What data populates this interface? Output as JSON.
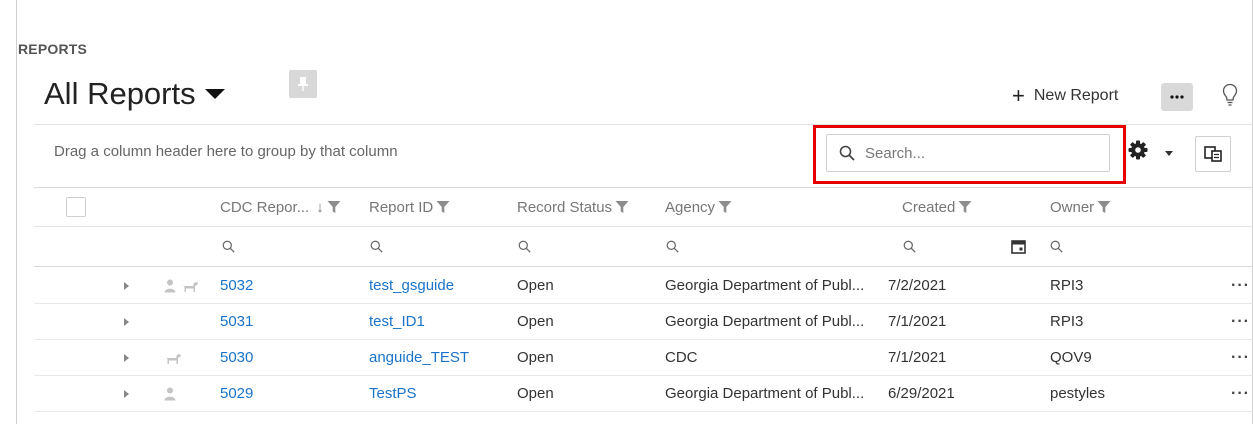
{
  "header": {
    "section": "REPORTS",
    "title": "All Reports",
    "new_report_label": "New Report"
  },
  "toolbar": {
    "group_hint": "Drag a column header here to group by that column",
    "search_placeholder": "Search..."
  },
  "table": {
    "columns": [
      "CDC Repor...",
      "Report ID",
      "Record Status",
      "Agency",
      "Created",
      "Owner"
    ],
    "sort_indicator": "↓",
    "rows": [
      {
        "icons": [
          "person-icon",
          "dog-icon"
        ],
        "cdc_report": "5032",
        "report_id": "test_gsguide",
        "status": "Open",
        "agency": "Georgia Department of Publ...",
        "created": "7/2/2021",
        "owner": "RPI3"
      },
      {
        "icons": [],
        "cdc_report": "5031",
        "report_id": "test_ID1",
        "status": "Open",
        "agency": "Georgia Department of Publ...",
        "created": "7/1/2021",
        "owner": "RPI3"
      },
      {
        "icons": [
          "dog-icon"
        ],
        "cdc_report": "5030",
        "report_id": "anguide_TEST",
        "status": "Open",
        "agency": "CDC",
        "created": "7/1/2021",
        "owner": "QOV9"
      },
      {
        "icons": [
          "person-icon"
        ],
        "cdc_report": "5029",
        "report_id": "TestPS",
        "status": "Open",
        "agency": "Georgia Department of Publ...",
        "created": "6/29/2021",
        "owner": "pestyles"
      }
    ],
    "row_menu": "···"
  },
  "colors": {
    "link": "#1a73c8",
    "highlight": "#e60000"
  }
}
